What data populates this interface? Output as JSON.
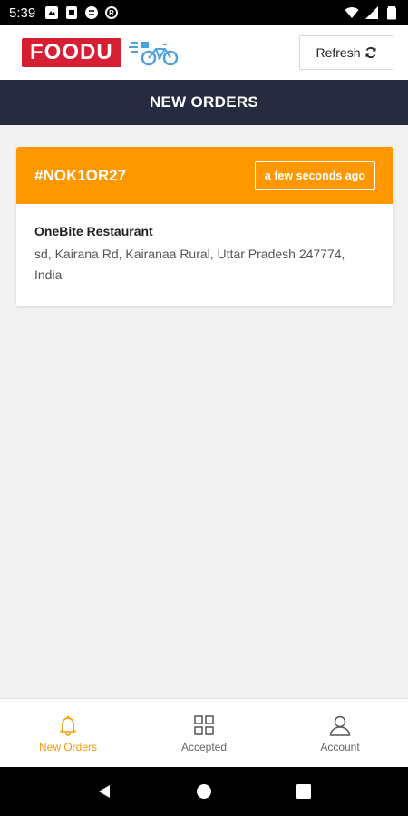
{
  "status_bar": {
    "time": "5:39",
    "left_icons": [
      "notification-icon",
      "sim-icon",
      "sync-icon",
      "data-saver-icon"
    ],
    "right_icons": [
      "wifi-icon",
      "signal-icon",
      "battery-icon"
    ]
  },
  "header": {
    "logo_text": "FOODU",
    "refresh_label": "Refresh"
  },
  "title_bar": {
    "title": "NEW ORDERS"
  },
  "orders": [
    {
      "id": "#NOK1OR27",
      "time": "a few seconds ago",
      "restaurant": "OneBite Restaurant",
      "address": "sd, Kairana Rd, Kairanaa Rural, Uttar Pradesh 247774, India"
    }
  ],
  "bottom_nav": {
    "items": [
      {
        "label": "New Orders",
        "icon": "bell-icon",
        "active": true
      },
      {
        "label": "Accepted",
        "icon": "grid-icon",
        "active": false
      },
      {
        "label": "Account",
        "icon": "user-icon",
        "active": false
      }
    ]
  },
  "colors": {
    "brand_red": "#d71f33",
    "accent_orange": "#ff9800",
    "title_bar": "#262b3f",
    "background": "#f2f2f2"
  }
}
